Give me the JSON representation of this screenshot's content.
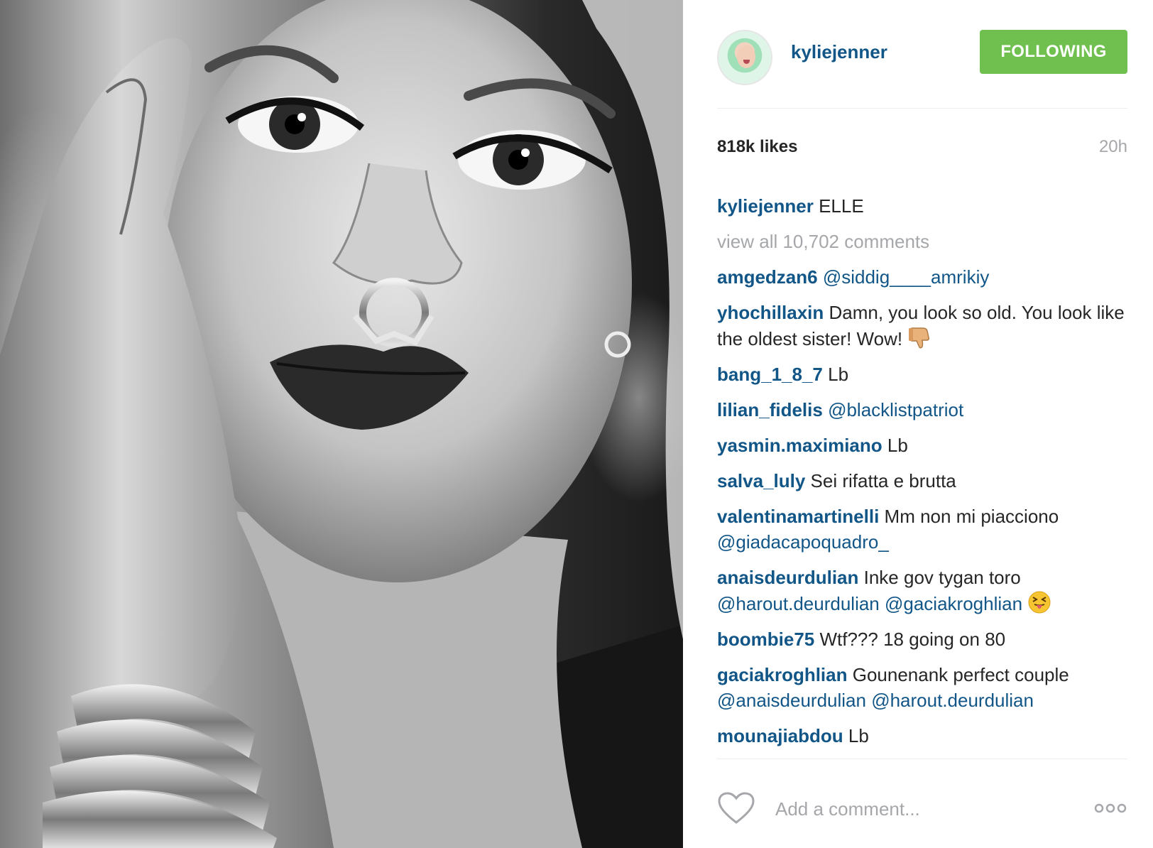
{
  "post": {
    "username": "kyliejenner",
    "follow_label": "FOLLOWING",
    "likes": "818k likes",
    "time_ago": "20h",
    "caption": {
      "user": "kyliejenner",
      "text": "ELLE"
    },
    "view_all_label": "view all 10,702 comments"
  },
  "comments": [
    {
      "user": "amgedzan6",
      "text": "",
      "mentions": "@siddig____amrikiy"
    },
    {
      "user": "yhochillaxin",
      "text": "Damn, you look so old. You look like the oldest sister! Wow!",
      "mentions": ""
    },
    {
      "user": "bang_1_8_7",
      "text": "Lb",
      "mentions": ""
    },
    {
      "user": "lilian_fidelis",
      "text": "",
      "mentions": "@blacklistpatriot"
    },
    {
      "user": "yasmin.maximiano",
      "text": "Lb",
      "mentions": ""
    },
    {
      "user": "salva_luly",
      "text": "Sei rifatta e brutta",
      "mentions": ""
    },
    {
      "user": "valentinamartinelli",
      "text": "Mm non mi piacciono",
      "mentions": "@giadacapoquadro_"
    },
    {
      "user": "anaisdeurdulian",
      "text": "Inke gov tygan toro",
      "mentions": "@harout.deurdulian @gaciakroghlian"
    },
    {
      "user": "boombie75",
      "text": "Wtf??? 18 going on 80",
      "mentions": ""
    },
    {
      "user": "gaciakroghlian",
      "text": "Gounenank perfect couple",
      "mentions": "@anaisdeurdulian @harout.deurdulian"
    },
    {
      "user": "mounajiabdou",
      "text": "Lb",
      "mentions": ""
    }
  ],
  "footer": {
    "placeholder": "Add a comment..."
  },
  "icons": {
    "heart": "heart-outline-icon",
    "more": "more-options-icon",
    "thumbs_down_emoji": "thumbs-down-emoji",
    "tongue_emoji": "squinting-tongue-emoji"
  },
  "colors": {
    "username_blue": "#125688",
    "follow_green": "#70c050",
    "muted_gray": "#a5a7aa",
    "text": "#262626"
  }
}
